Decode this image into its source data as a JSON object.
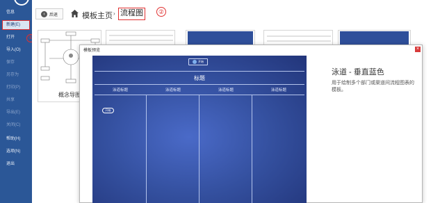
{
  "sidebar": {
    "items": [
      {
        "label": "信息",
        "state": "normal"
      },
      {
        "label": "新建(E)",
        "state": "active"
      },
      {
        "label": "打开",
        "state": "normal"
      },
      {
        "label": "导入(O)",
        "state": "normal"
      },
      {
        "label": "保存",
        "state": "dim"
      },
      {
        "label": "另存为",
        "state": "dim"
      },
      {
        "label": "打印(P)",
        "state": "dim"
      },
      {
        "label": "共享",
        "state": "dim"
      },
      {
        "label": "导出(E)",
        "state": "dim"
      },
      {
        "label": "关闭(C)",
        "state": "dim"
      },
      {
        "label": "帮助(H)",
        "state": "normal"
      },
      {
        "label": "选项(N)",
        "state": "normal"
      },
      {
        "label": "退出",
        "state": "normal"
      }
    ],
    "annotation": "①"
  },
  "toolbar": {
    "back_label": "后退",
    "breadcrumb_home": "模板主页",
    "breadcrumb_sep": "›",
    "breadcrumb_current": "流程图",
    "annotation": "②"
  },
  "gallery": {
    "cards": [
      {
        "label": "概念导图"
      }
    ]
  },
  "dialog": {
    "title": "模板预览",
    "close_glyph": "×",
    "template_name": "泳道 - 垂直蓝色",
    "template_desc": "用于绘制多个部门或渠道间流程图表的模板。",
    "preview": {
      "start_label": "开始",
      "main_title": "标题",
      "lane_titles": [
        "泳道标题",
        "泳道标题",
        "泳道标题",
        "泳道标题"
      ],
      "pill_label": "开始"
    }
  },
  "colors": {
    "sidebar_bg": "#2b5797",
    "preview_bg": "#34509f",
    "highlight_red": "#e03030"
  }
}
